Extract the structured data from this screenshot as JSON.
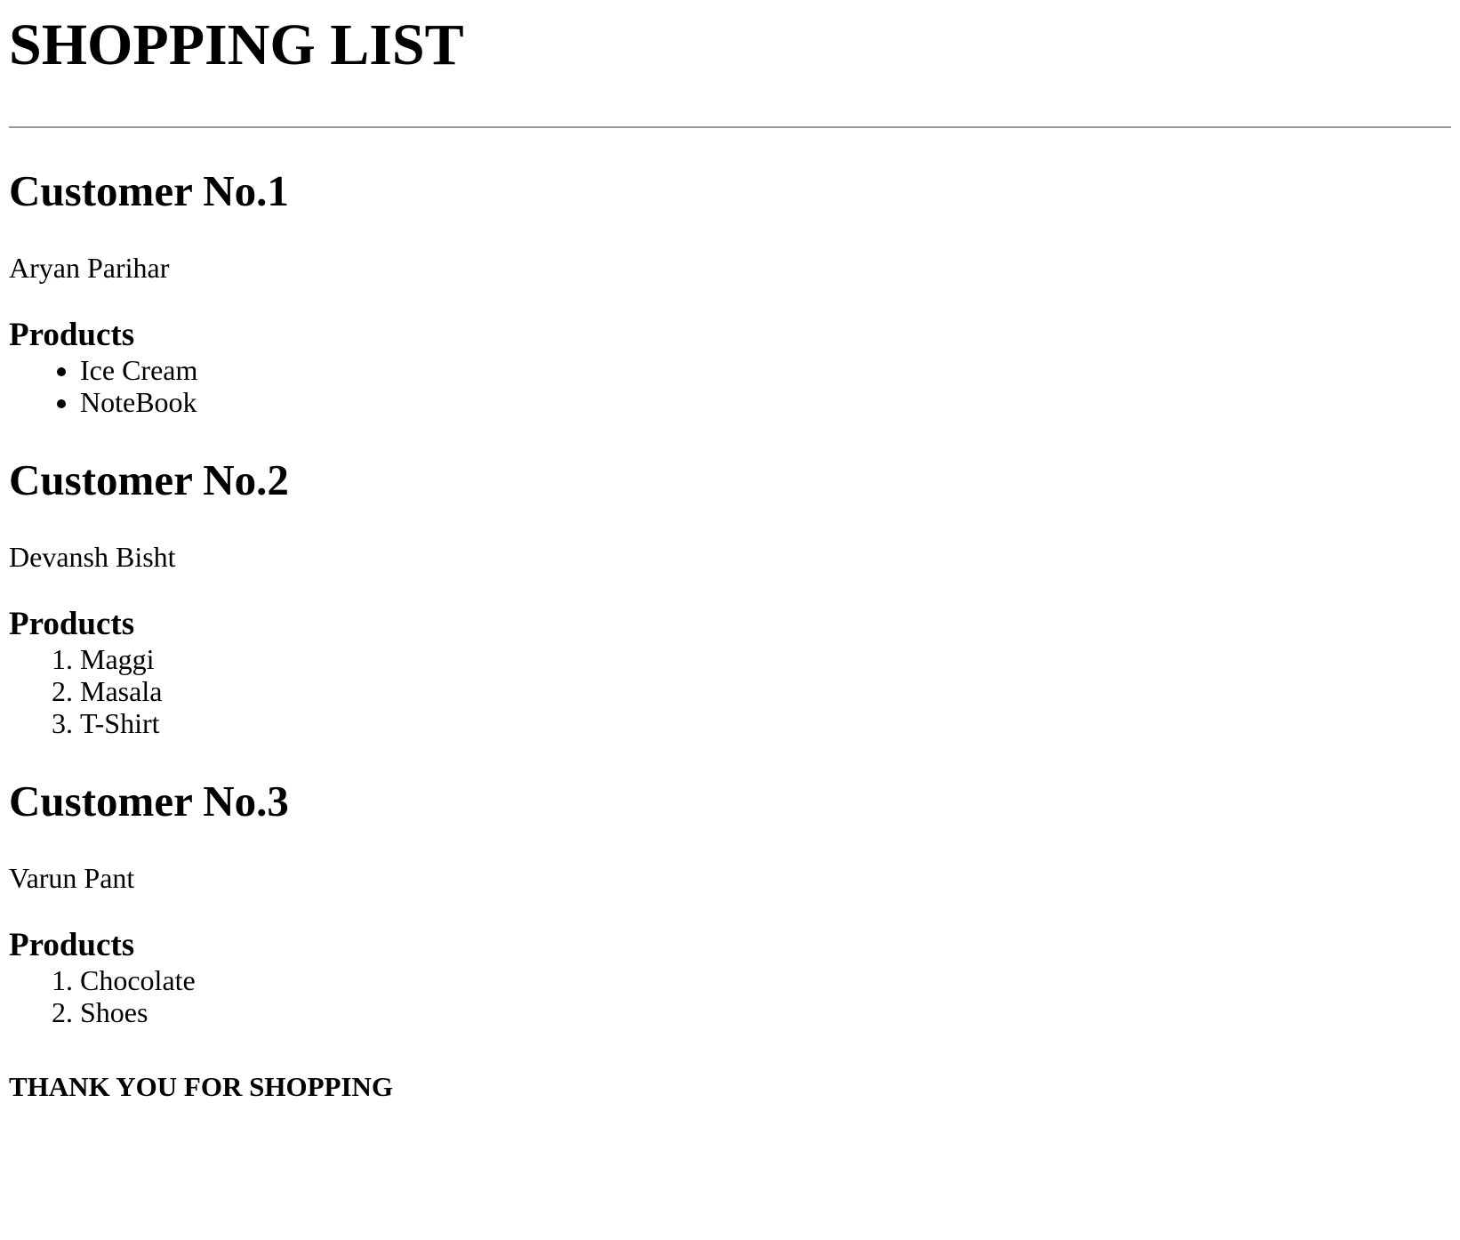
{
  "page": {
    "title": "SHOPPING LIST",
    "footer": "THANK YOU FOR SHOPPING"
  },
  "customers": [
    {
      "heading": "Customer No.1",
      "name": "Aryan Parihar",
      "products_heading": "Products",
      "list_style": "bullet",
      "products": [
        "Ice Cream",
        "NoteBook"
      ]
    },
    {
      "heading": "Customer No.2",
      "name": "Devansh Bisht",
      "products_heading": "Products",
      "list_style": "numbered",
      "products": [
        "Maggi",
        "Masala",
        "T-Shirt"
      ]
    },
    {
      "heading": "Customer No.3",
      "name": "Varun Pant",
      "products_heading": "Products",
      "list_style": "numbered",
      "products": [
        "Chocolate",
        "Shoes"
      ]
    }
  ]
}
